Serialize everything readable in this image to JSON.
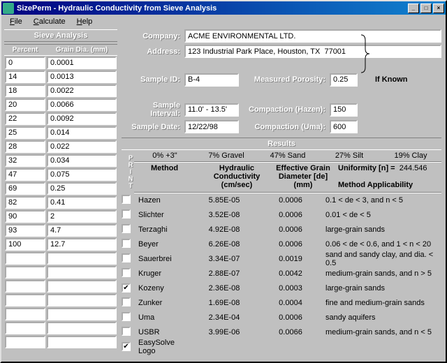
{
  "title": "SizePerm - Hydraulic Conductivity from Sieve Analysis",
  "menu": {
    "file": "File",
    "calculate": "Calculate",
    "help": "Help"
  },
  "sieve": {
    "title": "Sieve Analysis",
    "col1": "Percent",
    "col2": "Grain Dia. (mm)",
    "rows": [
      {
        "p": "0",
        "d": "0.0001"
      },
      {
        "p": "14",
        "d": "0.0013"
      },
      {
        "p": "18",
        "d": "0.0022"
      },
      {
        "p": "20",
        "d": "0.0066"
      },
      {
        "p": "22",
        "d": "0.0092"
      },
      {
        "p": "25",
        "d": "0.014"
      },
      {
        "p": "28",
        "d": "0.022"
      },
      {
        "p": "32",
        "d": "0.034"
      },
      {
        "p": "47",
        "d": "0.075"
      },
      {
        "p": "69",
        "d": "0.25"
      },
      {
        "p": "82",
        "d": "0.41"
      },
      {
        "p": "90",
        "d": "2"
      },
      {
        "p": "93",
        "d": "4.7"
      },
      {
        "p": "100",
        "d": "12.7"
      },
      {
        "p": "",
        "d": ""
      },
      {
        "p": "",
        "d": ""
      },
      {
        "p": "",
        "d": ""
      },
      {
        "p": "",
        "d": ""
      },
      {
        "p": "",
        "d": ""
      },
      {
        "p": "",
        "d": ""
      },
      {
        "p": "",
        "d": ""
      }
    ]
  },
  "form": {
    "company_l": "Company:",
    "company": "ACME ENVIRONMENTAL LTD.",
    "address_l": "Address:",
    "address": "123 Industrial Park Place, Houston, TX  77001",
    "sampleid_l": "Sample ID:",
    "sampleid": "B-4",
    "interval_l": "Sample Interval:",
    "interval": "11.0' - 13.5'",
    "date_l": "Sample Date:",
    "date": "12/22/98",
    "porosity_l": "Measured Porosity:",
    "porosity": "0.25",
    "hazen_l": "Compaction (Hazen):",
    "hazen": "150",
    "uma_l": "Compaction (Uma):",
    "uma": "600",
    "ifknown": "If Known"
  },
  "results": {
    "title": "Results",
    "print": "PRINT",
    "pcts": [
      "0% +3\"",
      "7% Gravel",
      "47% Sand",
      "27% Silt",
      "19% Clay"
    ],
    "head": {
      "method": "Method",
      "k": "Hydraulic Conductivity (cm/sec)",
      "de": "Effective Grain Diameter [de] (mm)",
      "unif_l": "Uniformity [n] =",
      "unif_v": "244.546",
      "app": "Method Applicability"
    },
    "rows": [
      {
        "ck": false,
        "m": "Hazen",
        "k": "5.85E-05",
        "de": "0.0006",
        "a": "0.1 < de < 3, and n < 5"
      },
      {
        "ck": false,
        "m": "Slichter",
        "k": "3.52E-08",
        "de": "0.0006",
        "a": "0.01 < de < 5"
      },
      {
        "ck": false,
        "m": "Terzaghi",
        "k": "4.92E-08",
        "de": "0.0006",
        "a": "large-grain sands"
      },
      {
        "ck": false,
        "m": "Beyer",
        "k": "6.26E-08",
        "de": "0.0006",
        "a": "0.06 < de < 0.6, and 1 < n < 20"
      },
      {
        "ck": false,
        "m": "Sauerbrei",
        "k": "3.34E-07",
        "de": "0.0019",
        "a": "sand and sandy clay, and dia. < 0.5"
      },
      {
        "ck": false,
        "m": "Kruger",
        "k": "2.88E-07",
        "de": "0.0042",
        "a": "medium-grain sands, and n > 5"
      },
      {
        "ck": true,
        "m": "Kozeny",
        "k": "2.36E-08",
        "de": "0.0003",
        "a": "large-grain sands"
      },
      {
        "ck": false,
        "m": "Zunker",
        "k": "1.69E-08",
        "de": "0.0004",
        "a": "fine and medium-grain sands"
      },
      {
        "ck": false,
        "m": "Uma",
        "k": "2.34E-04",
        "de": "0.0006",
        "a": "sandy aquifers"
      },
      {
        "ck": false,
        "m": "USBR",
        "k": "3.99E-06",
        "de": "0.0066",
        "a": "medium-grain sands, and n < 5"
      },
      {
        "ck": true,
        "m": "EasySolve Logo",
        "k": "",
        "de": "",
        "a": ""
      }
    ]
  }
}
